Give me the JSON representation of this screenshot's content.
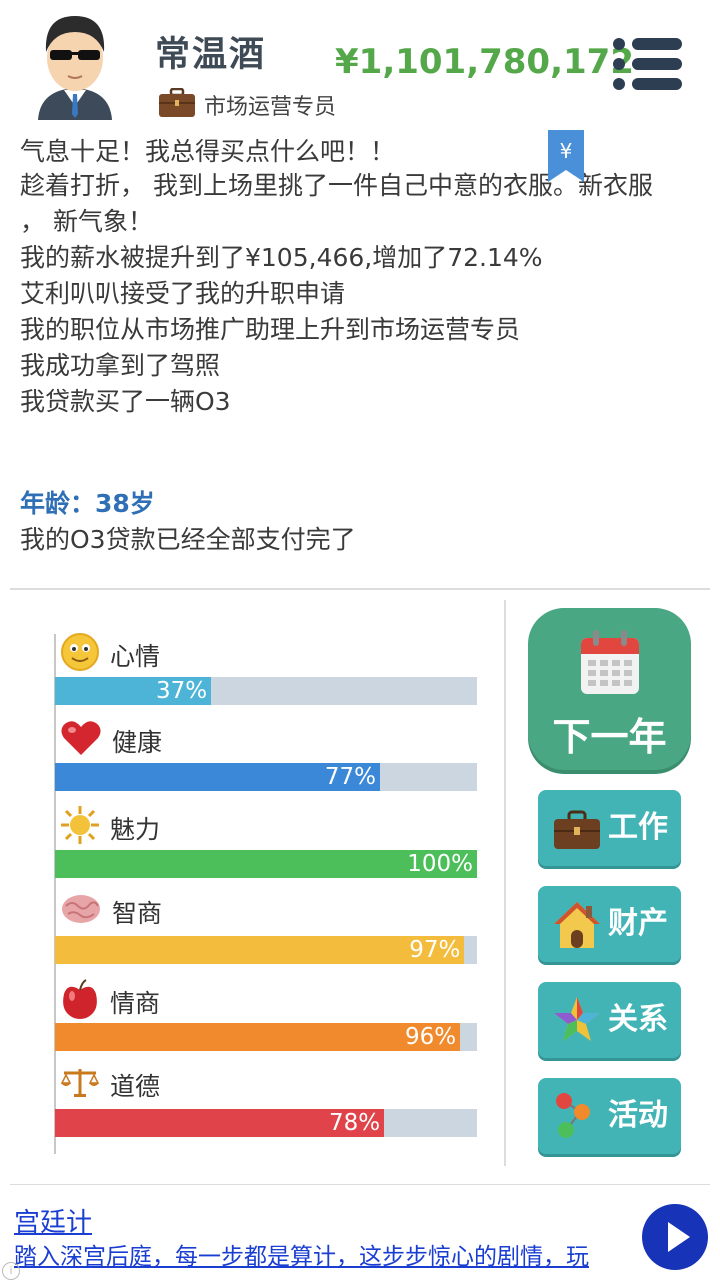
{
  "header": {
    "name": "常温酒",
    "money": "¥1,101,780,172",
    "job": "市场运营专员"
  },
  "log": {
    "lines": [
      "气息十足！我总得买点什么吧！！",
      "趁着打折， 我到上场里挑了一件自己中意的衣服。新衣服",
      "， 新气象！",
      "我的薪水被提升到了¥105,466,增加了72.14%",
      "艾利叭叭接受了我的升职申请",
      "我的职位从市场推广助理上升到市场运营专员",
      "我成功拿到了驾照",
      "我贷款买了一辆O3"
    ],
    "age": "年龄：38岁",
    "after_age": "我的O3贷款已经全部支付完了",
    "bookmark_symbol": "¥"
  },
  "stats": [
    {
      "label": "心情",
      "value": 37,
      "pct": "37%",
      "color": "#4db4d8",
      "icon": "smiley-icon"
    },
    {
      "label": "健康",
      "value": 77,
      "pct": "77%",
      "color": "#3b87d8",
      "icon": "heart-icon"
    },
    {
      "label": "魅力",
      "value": 100,
      "pct": "100%",
      "color": "#4cbf5a",
      "icon": "sun-icon"
    },
    {
      "label": "智商",
      "value": 97,
      "pct": "97%",
      "color": "#f4bc3c",
      "icon": "brain-icon"
    },
    {
      "label": "情商",
      "value": 96,
      "pct": "96%",
      "color": "#f08a2c",
      "icon": "apple-icon"
    },
    {
      "label": "道德",
      "value": 78,
      "pct": "78%",
      "color": "#e0444a",
      "icon": "scale-icon"
    }
  ],
  "buttons": {
    "next_year": "下一年",
    "work": "工作",
    "assets": "财产",
    "relations": "关系",
    "activities": "活动"
  },
  "ad": {
    "title": "宫廷计",
    "text": "踏入深宫后庭，每一步都是算计，这步步惊心的剧情，玩"
  }
}
